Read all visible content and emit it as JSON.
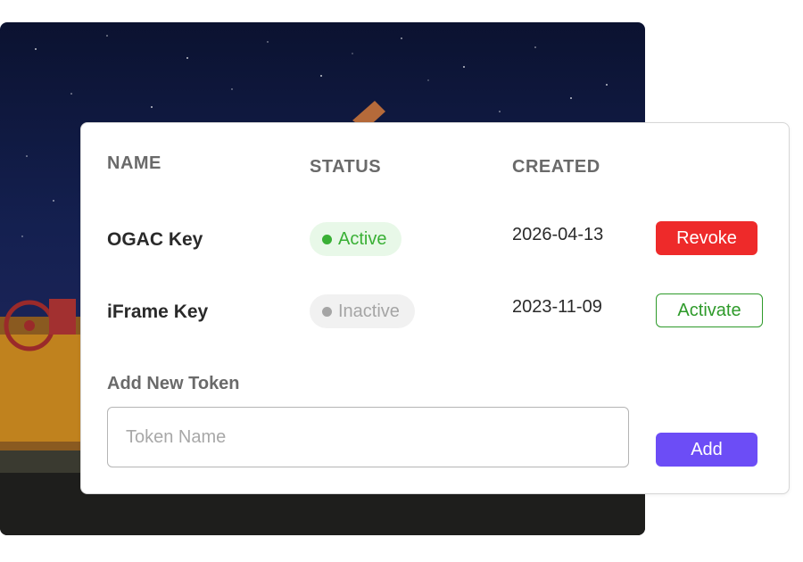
{
  "table": {
    "headers": {
      "name": "NAME",
      "status": "STATUS",
      "created": "CREATED"
    },
    "rows": [
      {
        "name": "OGAC Key",
        "status": "Active",
        "created": "2026-04-13",
        "action": "Revoke"
      },
      {
        "name": "iFrame Key",
        "status": "Inactive",
        "created": "2023-11-09",
        "action": "Activate"
      }
    ]
  },
  "add_token": {
    "title": "Add New Token",
    "placeholder": "Token Name",
    "button_label": "Add"
  },
  "colors": {
    "active_green": "#39b035",
    "revoke_red": "#ee2a2a",
    "add_purple": "#6c4df6",
    "activate_green": "#2e9a2a"
  },
  "icons": [
    "status-dot-icon"
  ]
}
